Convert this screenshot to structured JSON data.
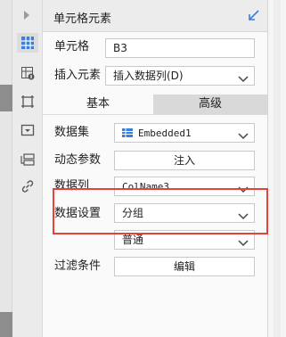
{
  "panel": {
    "title": "单元格元素",
    "cell": {
      "label": "单元格",
      "value": "B3"
    },
    "insert": {
      "label": "插入元素",
      "value": "插入数据列(D)"
    },
    "tabs": [
      {
        "label": "基本",
        "active": true
      },
      {
        "label": "高级",
        "active": false
      }
    ],
    "dataset": {
      "label": "数据集",
      "value": "Embedded1"
    },
    "dynamic_param": {
      "label": "动态参数",
      "button": "注入"
    },
    "data_column": {
      "label": "数据列",
      "value": "ColName3"
    },
    "data_setting": {
      "label": "数据设置",
      "value": "分组"
    },
    "group_mode": {
      "value": "普通"
    },
    "filter": {
      "label": "过滤条件",
      "button": "编辑"
    }
  },
  "sidebar_icons": [
    "expand-arrow-icon",
    "cell-element-icon",
    "cell-attribute-icon",
    "widget-icon",
    "form-control-icon",
    "hyperlink-icon"
  ],
  "colors": {
    "accent": "#3c7fd6",
    "highlight": "#e7413c",
    "tab_inactive": "#d9d9d9"
  }
}
